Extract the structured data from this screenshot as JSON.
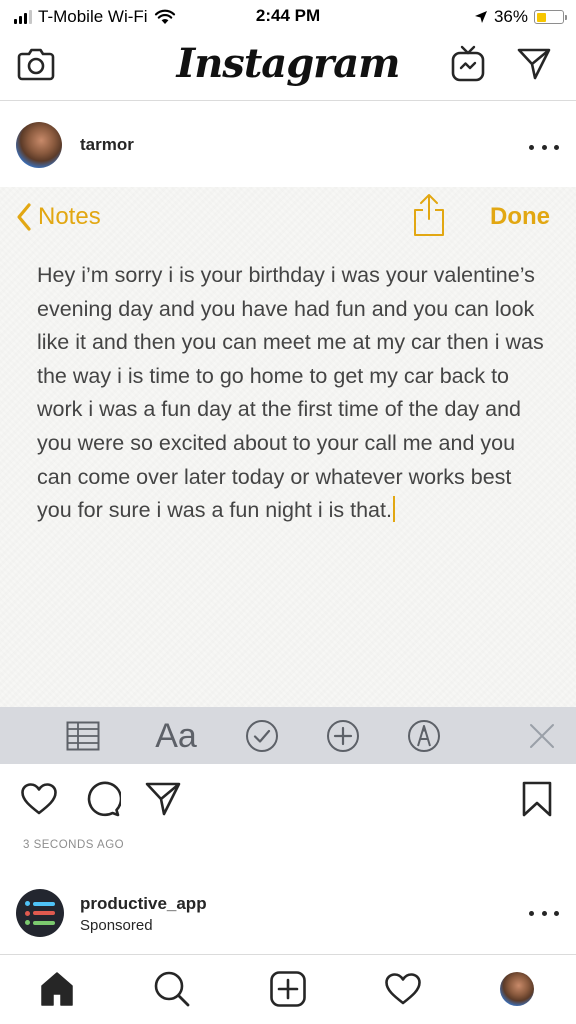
{
  "status_bar": {
    "carrier": "T-Mobile Wi-Fi",
    "time": "2:44 PM",
    "battery": "36%",
    "battery_level": 0.36,
    "icons": [
      "signal-icon",
      "wifi-icon",
      "location-arrow-icon",
      "battery-icon"
    ]
  },
  "header": {
    "logo": "Instagram",
    "icons": [
      "camera-icon",
      "igtv-icon",
      "direct-message-icon"
    ]
  },
  "post": {
    "username": "tarmor",
    "timestamp": "3 SECONDS AGO",
    "actions": [
      "heart-icon",
      "comment-icon",
      "share-icon",
      "bookmark-icon"
    ]
  },
  "notes": {
    "back_label": "Notes",
    "done_label": "Done",
    "accent": "#e2a712",
    "body": "Hey i’m sorry i is your birthday i was your valentine’s evening day and you have had fun and you can look like it and then you can meet me at my car then i was the way i is time to go home to get my car back to work i was a fun day at the first time of the day and you were so excited about to your call me and you can come over later today or whatever works best you for sure i was a fun night i is that.",
    "toolbar": {
      "format_label": "Aa",
      "icons": [
        "table-icon",
        "checklist-icon",
        "plus-circle-icon",
        "markup-pen-icon",
        "close-icon"
      ]
    }
  },
  "sponsored_post": {
    "username": "productive_app",
    "label": "Sponsored"
  },
  "tab_bar": {
    "icons": [
      "home-icon",
      "search-icon",
      "new-post-icon",
      "activity-heart-icon",
      "profile-avatar"
    ]
  }
}
